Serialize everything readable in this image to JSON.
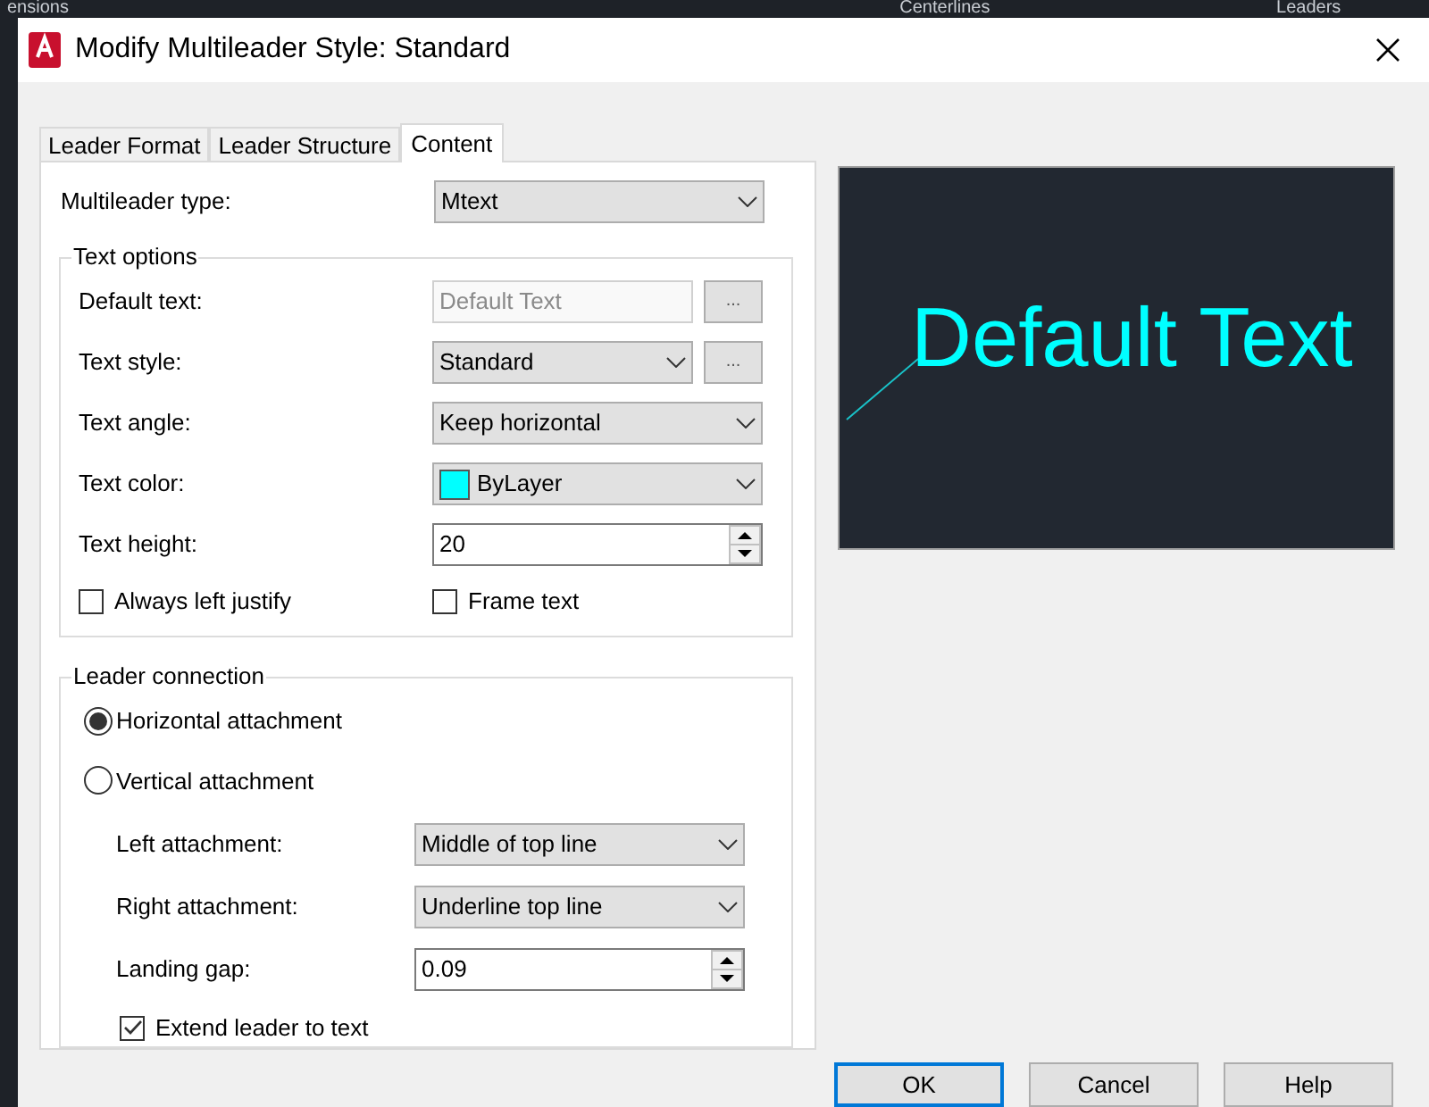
{
  "background": {
    "panel_titles": [
      "ensions",
      "Centerlines",
      "Leaders"
    ]
  },
  "window": {
    "title": "Modify Multileader Style: Standard"
  },
  "tabs": [
    {
      "label": "Leader Format",
      "selected": false
    },
    {
      "label": "Leader Structure",
      "selected": false
    },
    {
      "label": "Content",
      "selected": true
    }
  ],
  "multileader_type": {
    "label": "Multileader type:",
    "value": "Mtext"
  },
  "text_options": {
    "title": "Text options",
    "rows": [
      {
        "kind": "text",
        "label": "Default text:",
        "value": "Default Text",
        "disabled": true,
        "browse": "..."
      },
      {
        "kind": "dropdown",
        "label": "Text style:",
        "value": "Standard",
        "browse": "..."
      },
      {
        "kind": "dropdown",
        "label": "Text angle:",
        "value": "Keep horizontal"
      },
      {
        "kind": "color",
        "label": "Text color:",
        "value": "ByLayer",
        "color": "#00ffff"
      },
      {
        "kind": "spinner",
        "label": "Text height:",
        "value": "20"
      }
    ],
    "checkboxes": [
      {
        "label": "Always left justify",
        "checked": false
      },
      {
        "label": "Frame text",
        "checked": false
      }
    ]
  },
  "leader_connection": {
    "title": "Leader connection",
    "attachments": [
      {
        "label": "Horizontal attachment",
        "selected": true
      },
      {
        "label": "Vertical attachment",
        "selected": false
      }
    ],
    "rows": [
      {
        "kind": "dropdown",
        "label": "Left attachment:",
        "value": "Middle of top line"
      },
      {
        "kind": "dropdown",
        "label": "Right attachment:",
        "value": "Underline top line"
      },
      {
        "kind": "spinner",
        "label": "Landing gap:",
        "value": "0.09"
      }
    ],
    "checkbox": {
      "label": "Extend leader to text",
      "checked": true
    }
  },
  "preview": {
    "text": "Default Text"
  },
  "buttons": [
    {
      "label": "OK",
      "default": true
    },
    {
      "label": "Cancel",
      "default": false
    },
    {
      "label": "Help",
      "default": false
    }
  ]
}
